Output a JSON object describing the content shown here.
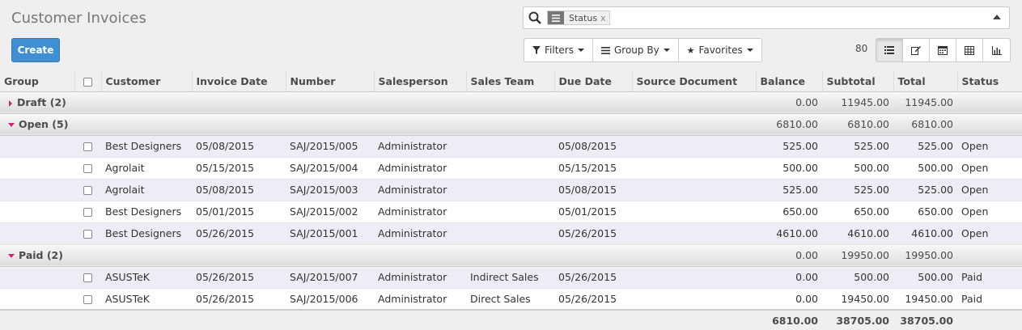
{
  "page": {
    "title": "Customer Invoices"
  },
  "toolbar": {
    "create_label": "Create"
  },
  "search": {
    "facet_label": "Status",
    "facet_remove": "x"
  },
  "filters": {
    "filters_label": "Filters",
    "groupby_label": "Group By",
    "favorites_label": "Favorites"
  },
  "pager": {
    "count": "80"
  },
  "columns": [
    "Group",
    "",
    "Customer",
    "Invoice Date",
    "Number",
    "Salesperson",
    "Sales Team",
    "Due Date",
    "Source Document",
    "Balance",
    "Subtotal",
    "Total",
    "Status"
  ],
  "groups": [
    {
      "label": "Draft (2)",
      "expanded": false,
      "balance": "0.00",
      "subtotal": "11945.00",
      "total": "11945.00",
      "rows": []
    },
    {
      "label": "Open (5)",
      "expanded": true,
      "balance": "6810.00",
      "subtotal": "6810.00",
      "total": "6810.00",
      "rows": [
        {
          "customer": "Best Designers",
          "invoice_date": "05/08/2015",
          "number": "SAJ/2015/005",
          "salesperson": "Administrator",
          "sales_team": "",
          "due_date": "05/08/2015",
          "source": "",
          "balance": "525.00",
          "subtotal": "525.00",
          "total": "525.00",
          "status": "Open"
        },
        {
          "customer": "Agrolait",
          "invoice_date": "05/15/2015",
          "number": "SAJ/2015/004",
          "salesperson": "Administrator",
          "sales_team": "",
          "due_date": "05/15/2015",
          "source": "",
          "balance": "500.00",
          "subtotal": "500.00",
          "total": "500.00",
          "status": "Open"
        },
        {
          "customer": "Agrolait",
          "invoice_date": "05/08/2015",
          "number": "SAJ/2015/003",
          "salesperson": "Administrator",
          "sales_team": "",
          "due_date": "05/08/2015",
          "source": "",
          "balance": "525.00",
          "subtotal": "525.00",
          "total": "525.00",
          "status": "Open"
        },
        {
          "customer": "Best Designers",
          "invoice_date": "05/01/2015",
          "number": "SAJ/2015/002",
          "salesperson": "Administrator",
          "sales_team": "",
          "due_date": "05/01/2015",
          "source": "",
          "balance": "650.00",
          "subtotal": "650.00",
          "total": "650.00",
          "status": "Open"
        },
        {
          "customer": "Best Designers",
          "invoice_date": "05/26/2015",
          "number": "SAJ/2015/001",
          "salesperson": "Administrator",
          "sales_team": "",
          "due_date": "05/26/2015",
          "source": "",
          "balance": "4610.00",
          "subtotal": "4610.00",
          "total": "4610.00",
          "status": "Open"
        }
      ]
    },
    {
      "label": "Paid (2)",
      "expanded": true,
      "balance": "0.00",
      "subtotal": "19950.00",
      "total": "19950.00",
      "rows": [
        {
          "customer": "ASUSTeK",
          "invoice_date": "05/26/2015",
          "number": "SAJ/2015/007",
          "salesperson": "Administrator",
          "sales_team": "Indirect Sales",
          "due_date": "05/26/2015",
          "source": "",
          "balance": "0.00",
          "subtotal": "500.00",
          "total": "500.00",
          "status": "Paid"
        },
        {
          "customer": "ASUSTeK",
          "invoice_date": "05/26/2015",
          "number": "SAJ/2015/006",
          "salesperson": "Administrator",
          "sales_team": "Direct Sales",
          "due_date": "05/26/2015",
          "source": "",
          "balance": "0.00",
          "subtotal": "19450.00",
          "total": "19450.00",
          "status": "Paid"
        }
      ]
    }
  ],
  "totals": {
    "balance": "6810.00",
    "subtotal": "38705.00",
    "total": "38705.00"
  },
  "colors": {
    "primary": "#3f8fd2",
    "group_caret": "#c02a70",
    "row_alt": "#ededf6"
  }
}
